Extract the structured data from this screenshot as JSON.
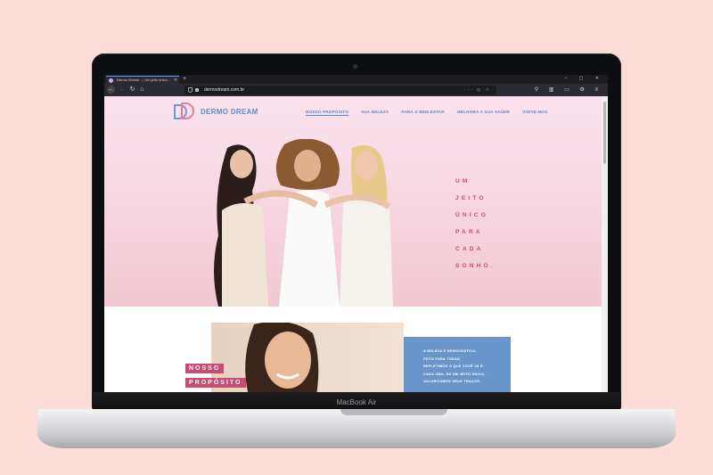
{
  "device": {
    "label": "MacBook Air"
  },
  "browser": {
    "tab_title": "Dermo Dream — Um jeito único...",
    "url": "dermodream.com.br"
  },
  "site": {
    "logo_text": "DERMO DREAM",
    "nav": [
      {
        "label": "NOSSO PROPÓSITO",
        "active": true
      },
      {
        "label": "SUA BELEZA"
      },
      {
        "label": "PARA O BEM ESTAR"
      },
      {
        "label": "MELHORA A SUA SAÚDE"
      },
      {
        "label": "VISITE-NOS"
      }
    ],
    "tagline": [
      "UM",
      "JEITO",
      "ÚNICO",
      "PARA",
      "CADA",
      "SONHO."
    ],
    "section_badges": [
      "NOSSO",
      "PROPÓSITO"
    ],
    "blue_text": [
      "A BELEZA É DEMOCRÁTICA,",
      "FEITA PARA TODAS.",
      "REFLETIMOS O QUE VOCÊ JÁ É:",
      "CADA UMA, DE UM JEITO ÚNICO,",
      "VALORIZAMOS SEUS TRAÇOS."
    ]
  },
  "colors": {
    "background": "#fbdcd8",
    "accent_pink": "#c94b72",
    "accent_blue": "#6a95cc",
    "hero_pink": "#f7d5e0"
  }
}
